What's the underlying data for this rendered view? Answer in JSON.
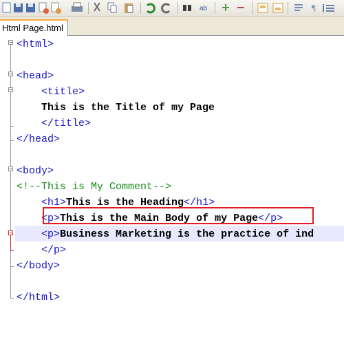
{
  "toolbar": {
    "buttons": [
      {
        "name": "new-file-icon",
        "color": "#5b7fbf"
      },
      {
        "name": "save-icon",
        "color": "#4a6fb0"
      },
      {
        "name": "save-all-icon",
        "color": "#4a6fb0"
      },
      {
        "name": "close-icon",
        "color": "#c86a3a"
      },
      {
        "name": "close-all-icon",
        "color": "#d88a3a"
      },
      {
        "name": "print-icon",
        "color": "#5a6a8a"
      },
      {
        "name": "cut-icon",
        "color": "#7a7a7a"
      },
      {
        "name": "copy-icon",
        "color": "#6a7a9a"
      },
      {
        "name": "paste-icon",
        "color": "#b08a3a"
      },
      {
        "name": "undo-icon",
        "color": "#2a8a2a"
      },
      {
        "name": "redo-icon",
        "color": "#6a6a6a"
      },
      {
        "name": "find-icon",
        "color": "#3a3a3a"
      },
      {
        "name": "replace-icon",
        "color": "#3a5aa0"
      },
      {
        "name": "zoom-in-icon",
        "color": "#4a9a4a"
      },
      {
        "name": "zoom-out-icon",
        "color": "#c04a4a"
      },
      {
        "name": "sync-vertical-icon",
        "color": "#d89a3a"
      },
      {
        "name": "sync-horizontal-icon",
        "color": "#d89a3a"
      },
      {
        "name": "word-wrap-icon",
        "color": "#4a6ab0"
      },
      {
        "name": "show-all-chars-icon",
        "color": "#6a8ac0"
      },
      {
        "name": "indent-guide-icon",
        "color": "#3a5aa0"
      }
    ]
  },
  "tab": {
    "label": "Html Page.html",
    "accent": "#f5a93b"
  },
  "code_lines": [
    [
      {
        "t": "<html>",
        "c": "tag"
      }
    ],
    [],
    [
      {
        "t": "<head>",
        "c": "tag"
      }
    ],
    [
      {
        "t": "    "
      },
      {
        "t": "<title>",
        "c": "tag"
      }
    ],
    [
      {
        "t": "    "
      },
      {
        "t": "This is the Title of my Page",
        "c": "txt"
      }
    ],
    [
      {
        "t": "    "
      },
      {
        "t": "</title>",
        "c": "tag"
      }
    ],
    [
      {
        "t": "</head>",
        "c": "tag"
      }
    ],
    [],
    [
      {
        "t": "<body>",
        "c": "tag"
      }
    ],
    [
      {
        "t": "<!--This is My Comment-->",
        "c": "cmt"
      }
    ],
    [
      {
        "t": "    "
      },
      {
        "t": "<h1>",
        "c": "tag"
      },
      {
        "t": "This is the Heading",
        "c": "txt"
      },
      {
        "t": "</h1>",
        "c": "tag"
      }
    ],
    [
      {
        "t": "    "
      },
      {
        "t": "<p>",
        "c": "tag"
      },
      {
        "t": "This is the Main Body of my Page",
        "c": "txt"
      },
      {
        "t": "</p>",
        "c": "tag"
      }
    ],
    [
      {
        "t": "    "
      },
      {
        "t": "<p>",
        "c": "tag"
      },
      {
        "t": "Business Marketing is the practice of ind",
        "c": "txt"
      }
    ],
    [
      {
        "t": "    "
      },
      {
        "t": "</p>",
        "c": "tag"
      }
    ],
    [
      {
        "t": "</body>",
        "c": "tag"
      }
    ],
    [],
    [
      {
        "t": "</html>",
        "c": "tag"
      }
    ]
  ],
  "colors": {
    "tag": "#1515c8",
    "comment": "#168a16",
    "text": "#000000",
    "highlight_box": "#e01b22",
    "current_line": "#e8e8ff"
  }
}
